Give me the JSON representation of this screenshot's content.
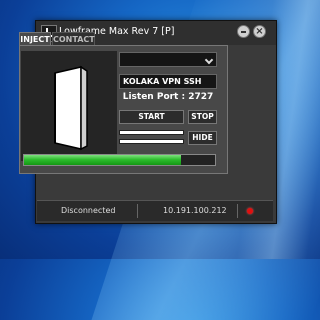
{
  "window": {
    "title": "Lowframe Max Rev 7 [P]"
  },
  "tabs": [
    {
      "label": "INJECT",
      "active": true
    },
    {
      "label": "CONTACT",
      "active": false
    }
  ],
  "inject": {
    "dropdown_value": "",
    "server_name": "KOLAKA VPN SSH",
    "listen_port": "Listen Port : 2727",
    "start_label": "START",
    "stop_label": "STOP",
    "hide_label": "HIDE",
    "progress": 0.82
  },
  "status": {
    "text": "Disconnected",
    "ip": "10.191.100.212",
    "indicator_color": "#e01010"
  }
}
